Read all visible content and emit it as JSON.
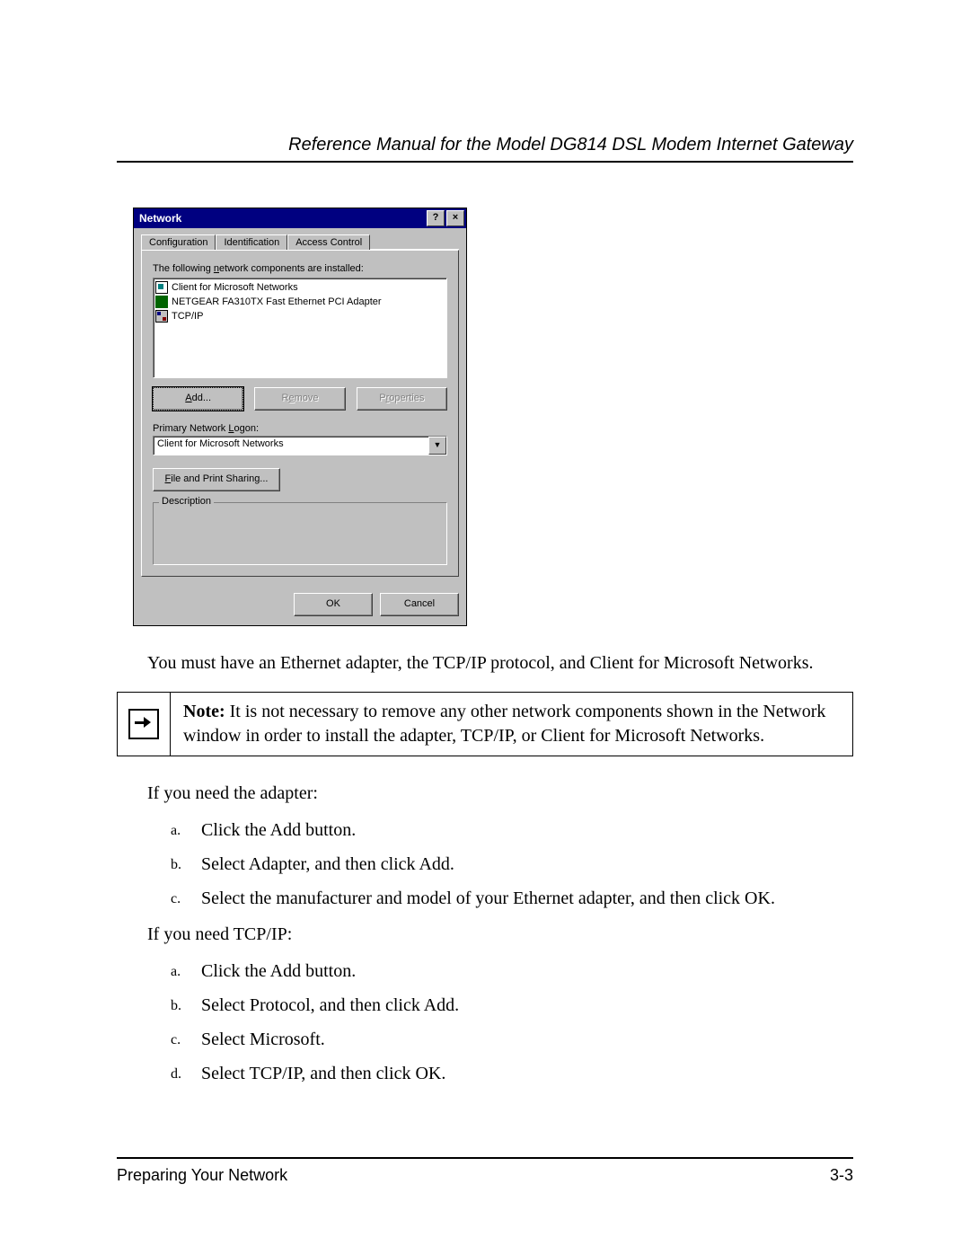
{
  "header": {
    "title": "Reference Manual for the Model DG814 DSL Modem Internet Gateway"
  },
  "dialog": {
    "title": "Network",
    "help_label": "?",
    "close_label": "×",
    "tabs": [
      "Configuration",
      "Identification",
      "Access Control"
    ],
    "list_label_pre": "The following ",
    "list_label_ul": "n",
    "list_label_post": "etwork components are installed:",
    "components": [
      "Client for Microsoft Networks",
      "NETGEAR FA310TX Fast Ethernet PCI Adapter",
      "TCP/IP"
    ],
    "btn_add_ul": "A",
    "btn_add_post": "dd...",
    "btn_remove_pre": "R",
    "btn_remove_ul": "e",
    "btn_remove_post": "move",
    "btn_props_pre": "P",
    "btn_props_ul": "r",
    "btn_props_post": "operties",
    "primary_label_pre": "Primary Network ",
    "primary_label_ul": "L",
    "primary_label_post": "ogon:",
    "primary_value": "Client for Microsoft Networks",
    "fps_ul": "F",
    "fps_post": "ile and Print Sharing...",
    "desc_legend": "Description",
    "ok": "OK",
    "cancel": "Cancel"
  },
  "body": {
    "intro": "You must have an Ethernet adapter, the TCP/IP protocol, and Client for Microsoft Networks.",
    "note_label": "Note:",
    "note_text": " It is not necessary to remove any other network components shown in the Network window in order to install the adapter, TCP/IP, or Client for Microsoft Networks.",
    "adapter_intro": "If you need the adapter:",
    "adapter_steps": [
      "Click the Add button.",
      "Select Adapter, and then click Add.",
      "Select the manufacturer and model of your Ethernet adapter, and then click OK."
    ],
    "tcpip_intro": "If you need TCP/IP:",
    "tcpip_steps": [
      "Click the Add button.",
      "Select Protocol, and then click Add.",
      "Select Microsoft.",
      "Select TCP/IP, and then click OK."
    ]
  },
  "footer": {
    "section": "Preparing Your Network",
    "page": "3-3"
  }
}
